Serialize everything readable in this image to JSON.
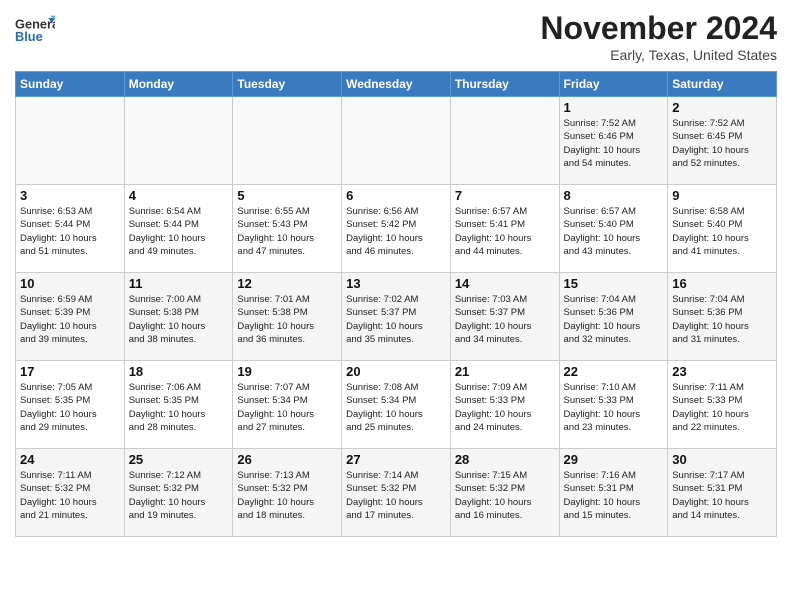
{
  "header": {
    "logo_general": "General",
    "logo_blue": "Blue",
    "month_title": "November 2024",
    "location": "Early, Texas, United States"
  },
  "days_of_week": [
    "Sunday",
    "Monday",
    "Tuesday",
    "Wednesday",
    "Thursday",
    "Friday",
    "Saturday"
  ],
  "weeks": [
    [
      {
        "day": "",
        "info": ""
      },
      {
        "day": "",
        "info": ""
      },
      {
        "day": "",
        "info": ""
      },
      {
        "day": "",
        "info": ""
      },
      {
        "day": "",
        "info": ""
      },
      {
        "day": "1",
        "info": "Sunrise: 7:52 AM\nSunset: 6:46 PM\nDaylight: 10 hours\nand 54 minutes."
      },
      {
        "day": "2",
        "info": "Sunrise: 7:52 AM\nSunset: 6:45 PM\nDaylight: 10 hours\nand 52 minutes."
      }
    ],
    [
      {
        "day": "3",
        "info": "Sunrise: 6:53 AM\nSunset: 5:44 PM\nDaylight: 10 hours\nand 51 minutes."
      },
      {
        "day": "4",
        "info": "Sunrise: 6:54 AM\nSunset: 5:44 PM\nDaylight: 10 hours\nand 49 minutes."
      },
      {
        "day": "5",
        "info": "Sunrise: 6:55 AM\nSunset: 5:43 PM\nDaylight: 10 hours\nand 47 minutes."
      },
      {
        "day": "6",
        "info": "Sunrise: 6:56 AM\nSunset: 5:42 PM\nDaylight: 10 hours\nand 46 minutes."
      },
      {
        "day": "7",
        "info": "Sunrise: 6:57 AM\nSunset: 5:41 PM\nDaylight: 10 hours\nand 44 minutes."
      },
      {
        "day": "8",
        "info": "Sunrise: 6:57 AM\nSunset: 5:40 PM\nDaylight: 10 hours\nand 43 minutes."
      },
      {
        "day": "9",
        "info": "Sunrise: 6:58 AM\nSunset: 5:40 PM\nDaylight: 10 hours\nand 41 minutes."
      }
    ],
    [
      {
        "day": "10",
        "info": "Sunrise: 6:59 AM\nSunset: 5:39 PM\nDaylight: 10 hours\nand 39 minutes."
      },
      {
        "day": "11",
        "info": "Sunrise: 7:00 AM\nSunset: 5:38 PM\nDaylight: 10 hours\nand 38 minutes."
      },
      {
        "day": "12",
        "info": "Sunrise: 7:01 AM\nSunset: 5:38 PM\nDaylight: 10 hours\nand 36 minutes."
      },
      {
        "day": "13",
        "info": "Sunrise: 7:02 AM\nSunset: 5:37 PM\nDaylight: 10 hours\nand 35 minutes."
      },
      {
        "day": "14",
        "info": "Sunrise: 7:03 AM\nSunset: 5:37 PM\nDaylight: 10 hours\nand 34 minutes."
      },
      {
        "day": "15",
        "info": "Sunrise: 7:04 AM\nSunset: 5:36 PM\nDaylight: 10 hours\nand 32 minutes."
      },
      {
        "day": "16",
        "info": "Sunrise: 7:04 AM\nSunset: 5:36 PM\nDaylight: 10 hours\nand 31 minutes."
      }
    ],
    [
      {
        "day": "17",
        "info": "Sunrise: 7:05 AM\nSunset: 5:35 PM\nDaylight: 10 hours\nand 29 minutes."
      },
      {
        "day": "18",
        "info": "Sunrise: 7:06 AM\nSunset: 5:35 PM\nDaylight: 10 hours\nand 28 minutes."
      },
      {
        "day": "19",
        "info": "Sunrise: 7:07 AM\nSunset: 5:34 PM\nDaylight: 10 hours\nand 27 minutes."
      },
      {
        "day": "20",
        "info": "Sunrise: 7:08 AM\nSunset: 5:34 PM\nDaylight: 10 hours\nand 25 minutes."
      },
      {
        "day": "21",
        "info": "Sunrise: 7:09 AM\nSunset: 5:33 PM\nDaylight: 10 hours\nand 24 minutes."
      },
      {
        "day": "22",
        "info": "Sunrise: 7:10 AM\nSunset: 5:33 PM\nDaylight: 10 hours\nand 23 minutes."
      },
      {
        "day": "23",
        "info": "Sunrise: 7:11 AM\nSunset: 5:33 PM\nDaylight: 10 hours\nand 22 minutes."
      }
    ],
    [
      {
        "day": "24",
        "info": "Sunrise: 7:11 AM\nSunset: 5:32 PM\nDaylight: 10 hours\nand 21 minutes."
      },
      {
        "day": "25",
        "info": "Sunrise: 7:12 AM\nSunset: 5:32 PM\nDaylight: 10 hours\nand 19 minutes."
      },
      {
        "day": "26",
        "info": "Sunrise: 7:13 AM\nSunset: 5:32 PM\nDaylight: 10 hours\nand 18 minutes."
      },
      {
        "day": "27",
        "info": "Sunrise: 7:14 AM\nSunset: 5:32 PM\nDaylight: 10 hours\nand 17 minutes."
      },
      {
        "day": "28",
        "info": "Sunrise: 7:15 AM\nSunset: 5:32 PM\nDaylight: 10 hours\nand 16 minutes."
      },
      {
        "day": "29",
        "info": "Sunrise: 7:16 AM\nSunset: 5:31 PM\nDaylight: 10 hours\nand 15 minutes."
      },
      {
        "day": "30",
        "info": "Sunrise: 7:17 AM\nSunset: 5:31 PM\nDaylight: 10 hours\nand 14 minutes."
      }
    ]
  ]
}
